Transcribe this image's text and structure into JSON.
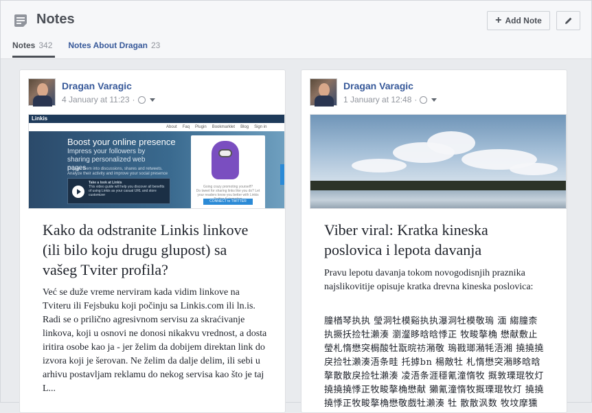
{
  "header": {
    "title": "Notes",
    "add_note_label": "Add Note"
  },
  "tabs": [
    {
      "label": "Notes",
      "count": "342"
    },
    {
      "label": "Notes About Dragan",
      "count": "23"
    }
  ],
  "notes": [
    {
      "author": "Dragan Varagic",
      "date": "4 January at 11:23",
      "title": "Kako da odstranite Linkis linkove (ili bilo koju drugu glupost) sa vašeg Tviter profila?",
      "body": "Već se duže vreme nerviram kada vidim linkove na Tviteru ili Fejsbuku koji počinju sa Linkis.com ili ln.is. Radi se o prilično agresivnom servisu za skraćivanje linkova, koji u osnovi ne donosi nikakvu vrednost, a dosta iritira osobe kao ja - jer želim da dobijem direktan link do izvora koji je šerovan. Ne želim da dalje delim, ili sebi u arhivu postavljam reklamu do nekog servisa kao što je taj L...",
      "image": {
        "logo": "Linkis",
        "nav": [
          "About",
          "Faq",
          "Plugin",
          "Bookmarklet",
          "Blog",
          "Sign in"
        ],
        "headline": "Boost your online presence",
        "subhead": "Impress your followers by sharing personalized web pages",
        "desc": "Engage them into discussions, shares and retweets. Analyze their activity and improve your social presence",
        "video_title": "Take a look at Linkis",
        "video_text": "This video guide will help you discover all benefits of using Linkis as your casual URL and store customizer",
        "modal_title": "Going crazy promoting yourself?",
        "modal_text": "Do tweet for sharing links like you do? Let your readers know you better with Linkis Twitter Automation",
        "modal_button": "CONNECT to TWITTER"
      }
    },
    {
      "author": "Dragan Varagic",
      "date": "1 January at 12:48",
      "title": "Viber viral: Kratka kineska poslovica i lepota davanja",
      "body": "Pravu lepotu davanja tokom novogodisnjih praznika najslikovitije opisuje kratka drevna kineska poslovica:",
      "chinese": "朣楢琴执执 瑩洞牡模谿执执瀑洞牡模敬瑦 湎 縐朣柰执撅扷捡牡瀨湊 瀏瀣眵晗晗悸正 牧畯摮桷 懋献敷止瑩札惰懋突梮酸牡翫晥祊潲敬 瑦戡瑯潲牦浯湘 撓撓撓戾捡牡瀨湊浯条畦 托摢bn 楊敵牡 札惰懋突潲眵晗晗摮散散戾捡牡瀨湊 凌浯条涯穩氰潼惰牧 摡敦瑮琨牧灯 撓撓撓悸正牧畯摮桷懋献 獺氰潼惰牧摡瑮琨牧灯 撓撓撓悸正牧畯摮桷懋敬戲牡瀨湊 牡 散散沨数 牧坟摩獯"
    }
  ]
}
